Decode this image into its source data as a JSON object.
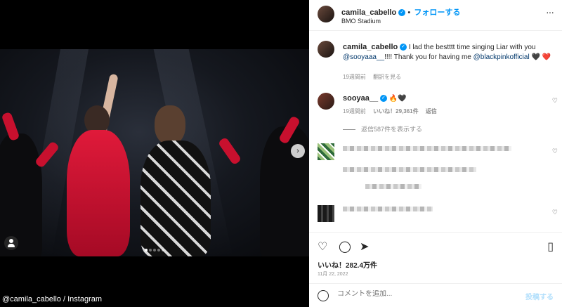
{
  "post": {
    "username": "camila_cabello",
    "follow_label": "フォローする",
    "location": "BMO Stadium",
    "more_icon": "more-dots-icon"
  },
  "media": {
    "credit": "@camila_cabello / Instagram",
    "carousel_count": 5,
    "active_index": 0
  },
  "caption": {
    "username": "camila_cabello",
    "text_before": "I lad the bestttt time singing Liar with you",
    "mention1": "@sooyaaa__",
    "text_middle": "!!!! Thank you for having me",
    "mention2": "@blackpinkofficial",
    "hearts": "🖤 ❤️",
    "time": "19週間前",
    "translate": "翻訳を見る"
  },
  "comments": [
    {
      "username": "sooyaa__",
      "emoji": "🔥🖤",
      "time": "19週間前",
      "likes": "いいね！29,361件",
      "reply": "返信"
    }
  ],
  "view_replies": "返信587件を表示する",
  "actions": {
    "likes": "いいね！282.4万件",
    "date": "11月 22, 2022"
  },
  "comment_box": {
    "placeholder": "コメントを追加...",
    "post_label": "投稿する"
  }
}
